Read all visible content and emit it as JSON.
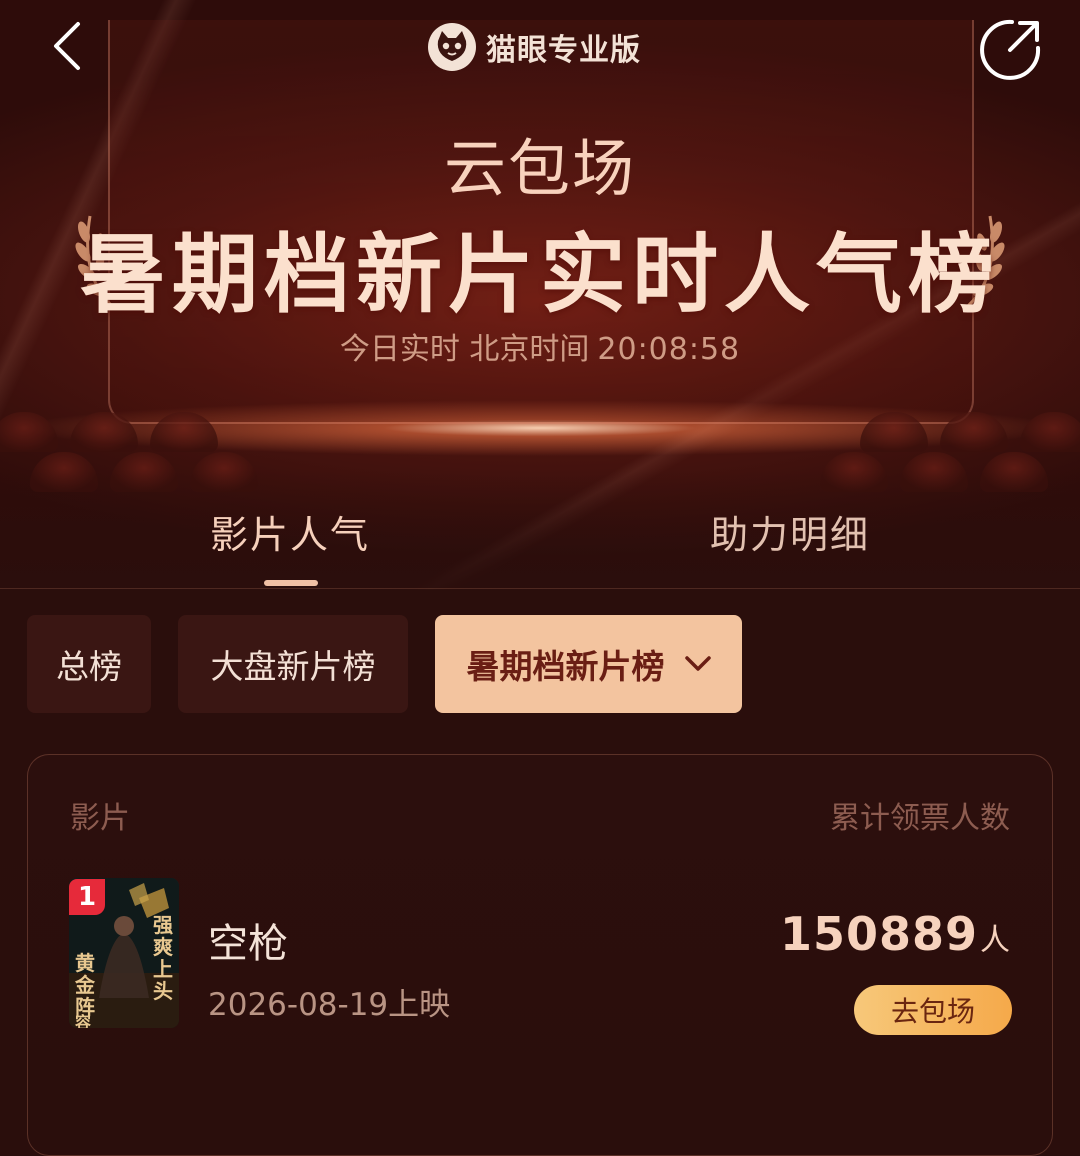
{
  "header": {
    "brand_name": "猫眼专业版",
    "back_icon": "chevron-left-icon",
    "share_icon": "share-icon",
    "logo_icon": "cat-logo-icon"
  },
  "hero": {
    "subtitle": "云包场",
    "title": "暑期档新片实时人气榜",
    "time_label": "今日实时 北京时间",
    "time_value": "20:08:58"
  },
  "tabs": [
    {
      "label": "影片人气",
      "active": true
    },
    {
      "label": "助力明细",
      "active": false
    }
  ],
  "filters": [
    {
      "label": "总榜",
      "selected": false
    },
    {
      "label": "大盘新片榜",
      "selected": false
    },
    {
      "label": "暑期档新片榜",
      "selected": true
    }
  ],
  "list": {
    "col_movie": "影片",
    "col_count": "累计领票人数",
    "items": [
      {
        "rank": "1",
        "name": "空枪",
        "release": "2026-08-19上映",
        "count": "150889",
        "unit": "人",
        "action": "去包场",
        "poster_text": [
          "强",
          "爽",
          "上",
          "头",
          "黄",
          "金",
          "阵",
          "容"
        ]
      }
    ]
  },
  "colors": {
    "accent": "#f3c49f",
    "badge": "#e62a3a",
    "button": "#f5a94a",
    "background": "#2a0e0c"
  }
}
